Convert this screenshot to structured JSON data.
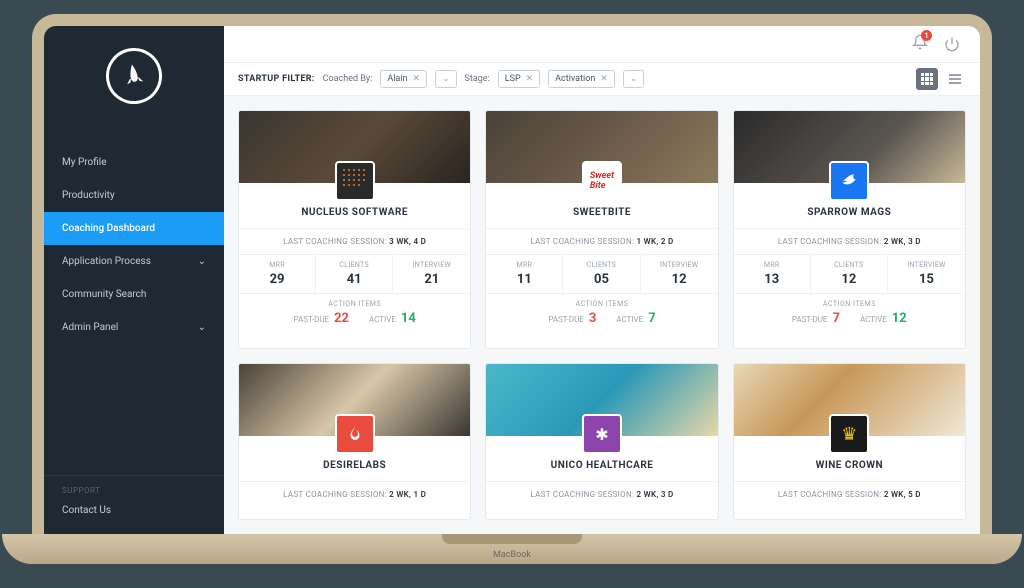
{
  "notifications": {
    "count": "1"
  },
  "sidebar": {
    "items": [
      {
        "label": "My Profile",
        "active": false,
        "expandable": false
      },
      {
        "label": "Productivity",
        "active": false,
        "expandable": false
      },
      {
        "label": "Coaching Dashboard",
        "active": true,
        "expandable": false
      },
      {
        "label": "Application Process",
        "active": false,
        "expandable": true
      },
      {
        "label": "Community Search",
        "active": false,
        "expandable": false
      },
      {
        "label": "Admin Panel",
        "active": false,
        "expandable": true
      }
    ],
    "support_header": "SUPPORT",
    "contact_label": "Contact Us"
  },
  "filter": {
    "title": "STARTUP FILTER:",
    "coached_by_label": "Coached By:",
    "coached_by_value": "Alain",
    "stage_label": "Stage:",
    "stage_values": [
      "LSP",
      "Activation"
    ]
  },
  "labels": {
    "last_session": "LAST COACHING SESSION:",
    "mrr": "MRR",
    "clients": "CLIENTS",
    "interview": "INTERVIEW",
    "action_items": "ACTION ITEMS",
    "past_due": "PAST-DUE",
    "active": "ACTIVE"
  },
  "cards": [
    {
      "name": "NUCLEUS SOFTWARE",
      "last": "3 WK, 4 D",
      "mrr": "29",
      "clients": "41",
      "interview": "21",
      "past_due": "22",
      "active": "14"
    },
    {
      "name": "SWEETBITE",
      "last": "1 WK, 2 D",
      "mrr": "11",
      "clients": "05",
      "interview": "12",
      "past_due": "3",
      "active": "7"
    },
    {
      "name": "SPARROW MAGS",
      "last": "2 WK, 3 D",
      "mrr": "13",
      "clients": "12",
      "interview": "15",
      "past_due": "7",
      "active": "12"
    },
    {
      "name": "DESIRELABS",
      "last": "2 WK, 1 D"
    },
    {
      "name": "UNICO HEALTHCARE",
      "last": "2 WK, 3 D"
    },
    {
      "name": "WINE CROWN",
      "last": "2 WK, 5 D"
    }
  ]
}
